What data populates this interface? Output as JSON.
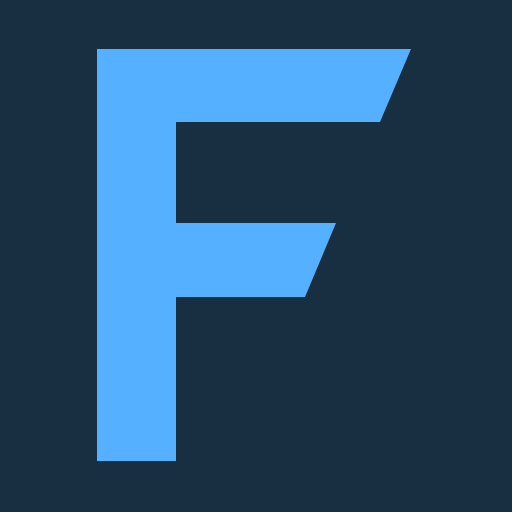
{
  "logo": {
    "letter": "F",
    "icon_name": "f-logo-icon"
  },
  "colors": {
    "background": "#172F40",
    "accent": "#55B0FF"
  }
}
